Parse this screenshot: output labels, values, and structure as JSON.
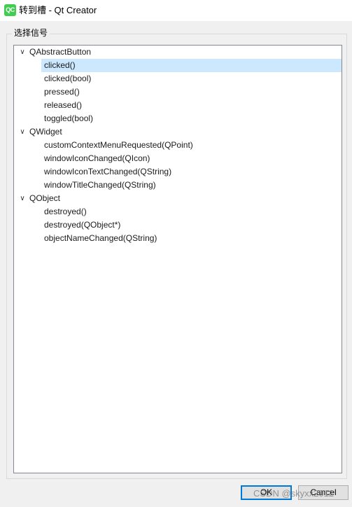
{
  "window": {
    "app_icon": "QC",
    "title": "转到槽 - Qt Creator"
  },
  "group": {
    "title": "选择信号"
  },
  "tree": {
    "nodes": [
      {
        "label": "QAbstractButton",
        "expanded": true,
        "children": [
          {
            "label": "clicked()",
            "selected": true
          },
          {
            "label": "clicked(bool)",
            "selected": false
          },
          {
            "label": "pressed()",
            "selected": false
          },
          {
            "label": "released()",
            "selected": false
          },
          {
            "label": "toggled(bool)",
            "selected": false
          }
        ]
      },
      {
        "label": "QWidget",
        "expanded": true,
        "children": [
          {
            "label": "customContextMenuRequested(QPoint)",
            "selected": false
          },
          {
            "label": "windowIconChanged(QIcon)",
            "selected": false
          },
          {
            "label": "windowIconTextChanged(QString)",
            "selected": false
          },
          {
            "label": "windowTitleChanged(QString)",
            "selected": false
          }
        ]
      },
      {
        "label": "QObject",
        "expanded": true,
        "children": [
          {
            "label": "destroyed()",
            "selected": false
          },
          {
            "label": "destroyed(QObject*)",
            "selected": false
          },
          {
            "label": "objectNameChanged(QString)",
            "selected": false
          }
        ]
      }
    ]
  },
  "buttons": {
    "ok": "OK",
    "cancel": "Cancel"
  },
  "watermark": "CSDN @skyxx2012",
  "colors": {
    "selection": "#cce8ff",
    "dialog_bg": "#f0f0f0",
    "default_button_border": "#0078d7",
    "qt_green": "#41cd52"
  },
  "icons": {
    "app": "qt-creator-icon",
    "expand": "chevron-down-icon"
  }
}
